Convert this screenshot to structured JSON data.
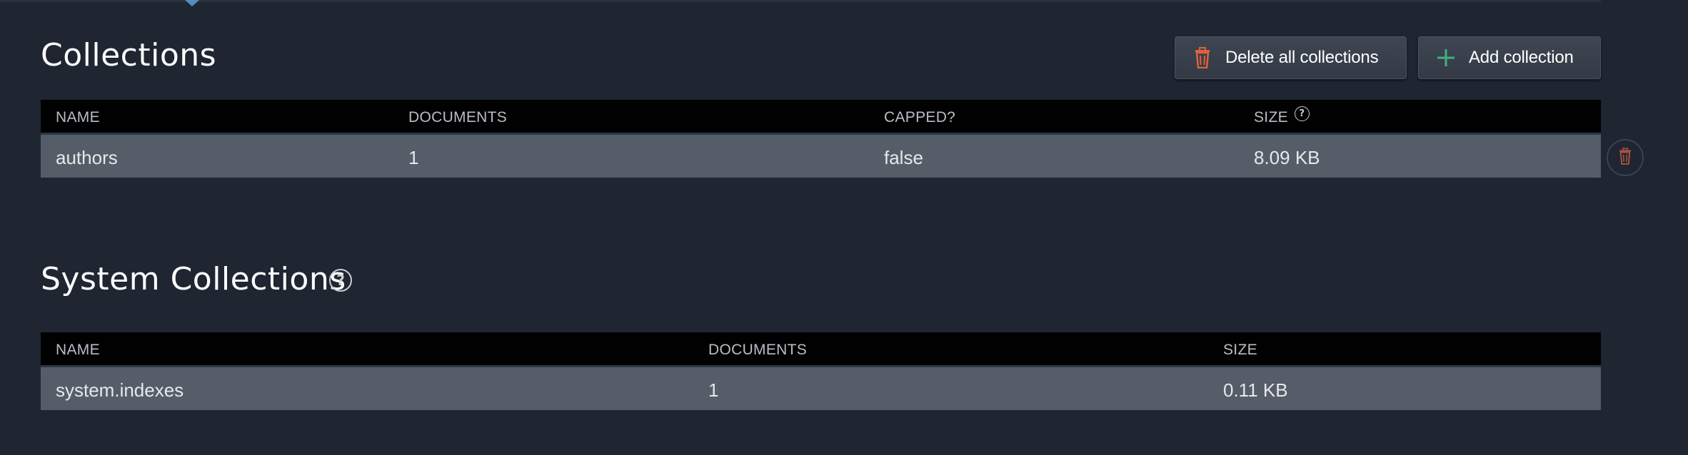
{
  "collections": {
    "title": "Collections",
    "buttons": {
      "delete_all_label": "Delete all collections",
      "add_label": "Add collection"
    },
    "columns": {
      "name": "NAME",
      "documents": "DOCUMENTS",
      "capped": "CAPPED?",
      "size": "SIZE"
    },
    "rows": [
      {
        "name": "authors",
        "documents": "1",
        "capped": "false",
        "size": "8.09 KB"
      }
    ]
  },
  "system_collections": {
    "title": "System Collections",
    "columns": {
      "name": "NAME",
      "documents": "DOCUMENTS",
      "size": "SIZE"
    },
    "rows": [
      {
        "name": "system.indexes",
        "documents": "1",
        "size": "0.11 KB"
      }
    ]
  },
  "icons": {
    "trash": "trash-icon",
    "plus": "plus-icon",
    "help": "help-circle-icon",
    "help_glyph": "?"
  },
  "colors": {
    "background": "#1f2631",
    "table_header": "#010101",
    "row": "#555d68",
    "trash_accent": "#e0603f",
    "plus_accent": "#3fb27f"
  }
}
